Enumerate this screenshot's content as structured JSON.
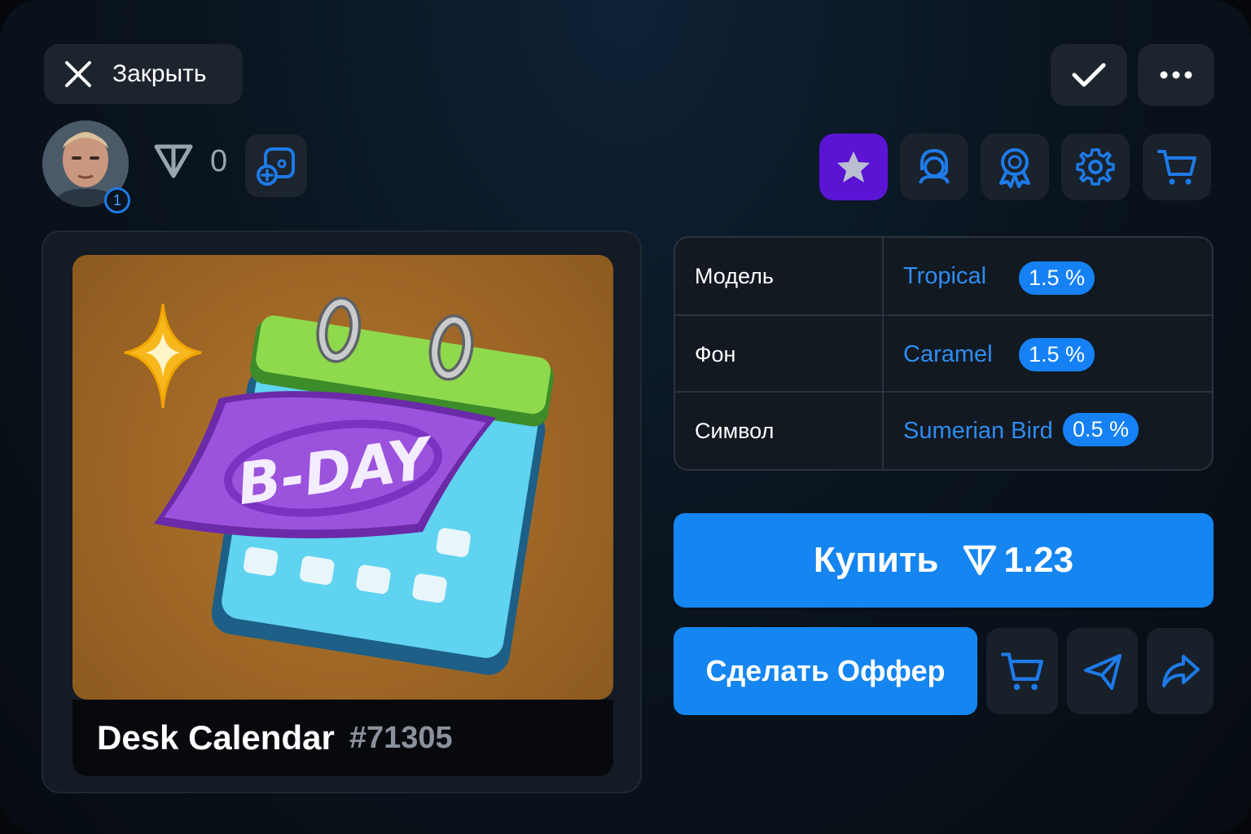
{
  "header": {
    "close_label": "Закрыть"
  },
  "profile": {
    "badge_count": "1",
    "ton_balance": "0"
  },
  "toolbar_icons": [
    "star-icon",
    "support-icon",
    "award-icon",
    "gear-icon",
    "cart-icon"
  ],
  "gift": {
    "name": "Desk Calendar",
    "number": "#71305",
    "artwork_text": "B-DAY"
  },
  "attributes": [
    {
      "key": "Модель",
      "value": "Tropical",
      "rarity": "1.5 %"
    },
    {
      "key": "Фон",
      "value": "Caramel",
      "rarity": "1.5 %"
    },
    {
      "key": "Символ",
      "value": "Sumerian Bird",
      "rarity": "0.5 %"
    }
  ],
  "actions": {
    "buy_label": "Купить",
    "buy_price": "1.23",
    "offer_label": "Сделать Оффер"
  },
  "colors": {
    "accent": "#1485f1",
    "active_tab": "#5b14d4",
    "background": "#0a1520"
  }
}
